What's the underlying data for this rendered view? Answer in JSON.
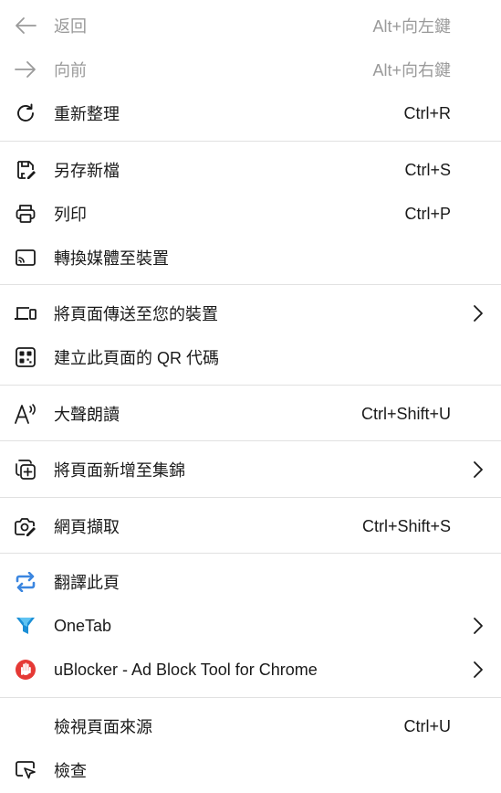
{
  "menu": {
    "items": [
      {
        "label": "返回",
        "shortcut": "Alt+向左鍵",
        "icon": "arrow-left-icon",
        "disabled": true
      },
      {
        "label": "向前",
        "shortcut": "Alt+向右鍵",
        "icon": "arrow-right-icon",
        "disabled": true
      },
      {
        "label": "重新整理",
        "shortcut": "Ctrl+R",
        "icon": "refresh-icon"
      },
      {
        "label": "另存新檔",
        "shortcut": "Ctrl+S",
        "icon": "save-as-icon"
      },
      {
        "label": "列印",
        "shortcut": "Ctrl+P",
        "icon": "printer-icon"
      },
      {
        "label": "轉換媒體至裝置",
        "shortcut": "",
        "icon": "cast-icon"
      },
      {
        "label": "將頁面傳送至您的裝置",
        "shortcut": "",
        "icon": "devices-icon",
        "submenu": true
      },
      {
        "label": "建立此頁面的 QR 代碼",
        "shortcut": "",
        "icon": "qr-code-icon"
      },
      {
        "label": "大聲朗讀",
        "shortcut": "Ctrl+Shift+U",
        "icon": "read-aloud-icon"
      },
      {
        "label": "將頁面新增至集錦",
        "shortcut": "",
        "icon": "collections-add-icon",
        "submenu": true
      },
      {
        "label": "網頁擷取",
        "shortcut": "Ctrl+Shift+S",
        "icon": "web-capture-icon"
      },
      {
        "label": "翻譯此頁",
        "shortcut": "",
        "icon": "translate-icon"
      },
      {
        "label": "OneTab",
        "shortcut": "",
        "icon": "onetab-funnel-icon",
        "submenu": true
      },
      {
        "label": "uBlocker - Ad Block Tool for Chrome",
        "shortcut": "",
        "icon": "ublocker-hand-icon",
        "submenu": true
      },
      {
        "label": "檢視頁面來源",
        "shortcut": "Ctrl+U",
        "icon": ""
      },
      {
        "label": "檢查",
        "shortcut": "",
        "icon": "inspect-icon"
      }
    ]
  },
  "colors": {
    "text": "#1a1a1a",
    "disabled": "#9a9a9a",
    "separator": "#e1e1e1",
    "translate_blue": "#3b86e0",
    "onetab_blue": "#1c8fd6",
    "ublocker_red": "#e53935"
  }
}
